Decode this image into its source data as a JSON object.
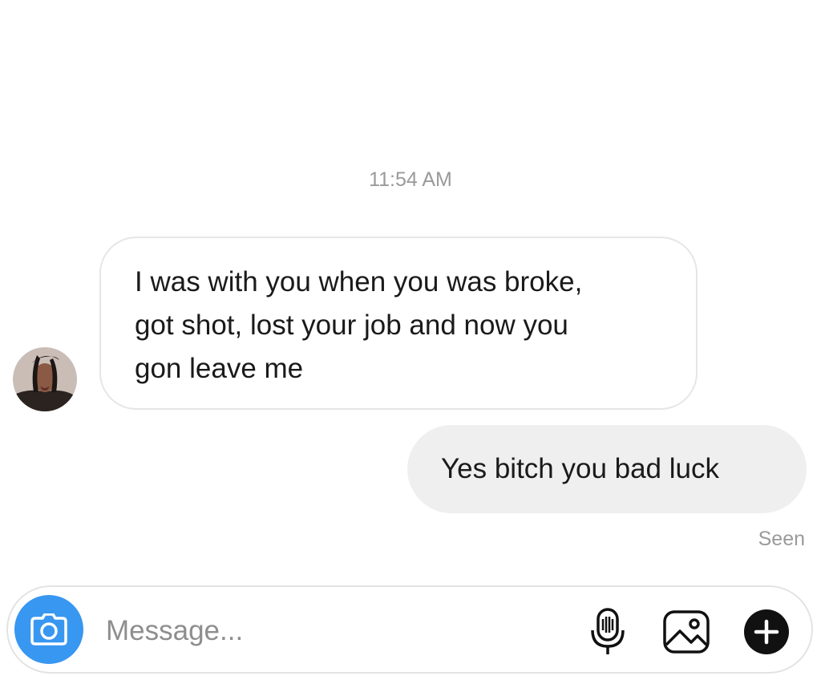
{
  "conversation": {
    "timestamp": "11:54 AM",
    "messages": [
      {
        "sender": "other",
        "lines": [
          "I was with you when you was broke,",
          "got shot, lost your job and now you",
          "gon leave me"
        ]
      },
      {
        "sender": "me",
        "text": "Yes bitch you bad luck"
      }
    ],
    "seen_label": "Seen"
  },
  "composer": {
    "placeholder": "Message...",
    "value": ""
  },
  "icons": {
    "camera": "camera-icon",
    "microphone": "microphone-icon",
    "gallery": "gallery-icon",
    "plus": "plus-icon"
  },
  "colors": {
    "accent_blue": "#3897f0",
    "outgoing_bubble": "#efefef",
    "incoming_border": "#e6e6e6",
    "meta_text": "#9a9a9a"
  }
}
